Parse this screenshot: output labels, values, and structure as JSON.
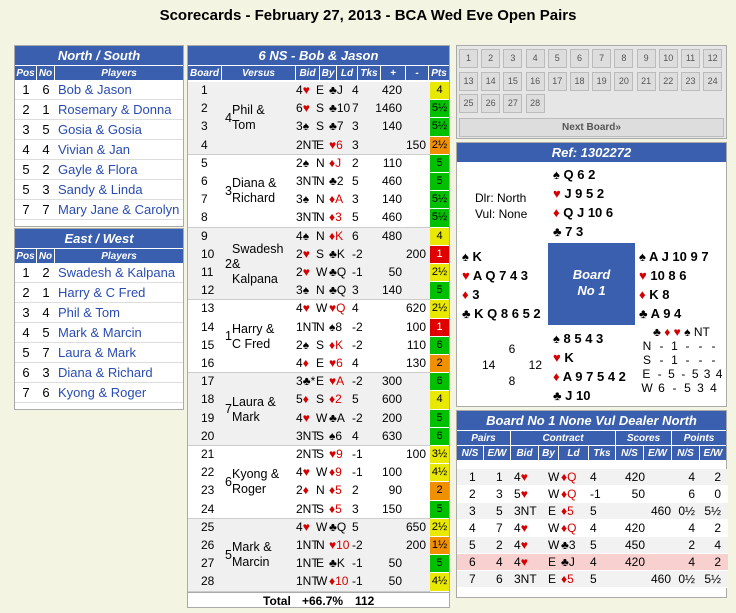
{
  "title": "Scorecards - February 27, 2013 - BCA Wed Eve Open Pairs",
  "ns": {
    "header": "North / South",
    "cols": [
      "Pos",
      "No",
      "Players"
    ],
    "rows": [
      [
        "1",
        "6",
        "Bob & Jason"
      ],
      [
        "2",
        "1",
        "Rosemary & Donna"
      ],
      [
        "3",
        "5",
        "Gosia & Gosia"
      ],
      [
        "4",
        "4",
        "Vivian & Jan"
      ],
      [
        "5",
        "2",
        "Gayle & Flora"
      ],
      [
        "5",
        "3",
        "Sandy & Linda"
      ],
      [
        "7",
        "7",
        "Mary Jane & Carolyn"
      ]
    ]
  },
  "ew": {
    "header": "East / West",
    "cols": [
      "Pos",
      "No",
      "Players"
    ],
    "rows": [
      [
        "1",
        "2",
        "Swadesh & Kalpana"
      ],
      [
        "2",
        "1",
        "Harry & C Fred"
      ],
      [
        "3",
        "4",
        "Phil & Tom"
      ],
      [
        "4",
        "5",
        "Mark & Marcin"
      ],
      [
        "5",
        "7",
        "Laura & Mark"
      ],
      [
        "6",
        "3",
        "Diana & Richard"
      ],
      [
        "7",
        "6",
        "Kyong & Roger"
      ]
    ]
  },
  "card": {
    "header": "6 NS - Bob & Jason",
    "cols": [
      "Board",
      "Versus",
      "Bid",
      "By",
      "Ld",
      "Tks",
      "+",
      "-",
      "Pts"
    ],
    "groups": [
      {
        "num": "4",
        "name": "Phil &\nTom"
      },
      {
        "num": "3",
        "name": "Diana &\nRichard"
      },
      {
        "num": "2",
        "name": "Swadesh\n&\nKalpana"
      },
      {
        "num": "1",
        "name": "Harry &\nC Fred"
      },
      {
        "num": "7",
        "name": "Laura &\nMark"
      },
      {
        "num": "6",
        "name": "Kyong &\nRoger"
      },
      {
        "num": "5",
        "name": "Mark &\nMarcin"
      }
    ],
    "rows": [
      [
        "1",
        "4",
        "♥",
        "E",
        "♣J",
        "4",
        "420",
        "",
        "4",
        "y"
      ],
      [
        "2",
        "6",
        "♥",
        "S",
        "♣10",
        "7",
        "1460",
        "",
        "5½",
        "g"
      ],
      [
        "3",
        "3",
        "♠",
        "S",
        "♣7",
        "3",
        "140",
        "",
        "5½",
        "g"
      ],
      [
        "4",
        "2NT",
        "",
        "E",
        "♥6",
        "3",
        "",
        "150",
        "2½",
        "o"
      ],
      [
        "5",
        "2",
        "♠",
        "N",
        "♦J",
        "2",
        "110",
        "",
        "5",
        "g"
      ],
      [
        "6",
        "3NT",
        "",
        "N",
        "♣2",
        "5",
        "460",
        "",
        "5",
        "g"
      ],
      [
        "7",
        "3",
        "♠",
        "N",
        "♦A",
        "3",
        "140",
        "",
        "5½",
        "g"
      ],
      [
        "8",
        "3NT",
        "",
        "N",
        "♦3",
        "5",
        "460",
        "",
        "5½",
        "g"
      ],
      [
        "9",
        "4",
        "♠",
        "N",
        "♦K",
        "6",
        "480",
        "",
        "4",
        "y"
      ],
      [
        "10",
        "2",
        "♥",
        "S",
        "♣K",
        "-2",
        "",
        "200",
        "1",
        "rd"
      ],
      [
        "11",
        "2",
        "♥",
        "W",
        "♣Q",
        "-1",
        "50",
        "",
        "2½",
        "y"
      ],
      [
        "12",
        "3",
        "♠",
        "N",
        "♣Q",
        "3",
        "140",
        "",
        "5",
        "g"
      ],
      [
        "13",
        "4",
        "♥",
        "W",
        "♥Q",
        "4",
        "",
        "620",
        "2½",
        "y"
      ],
      [
        "14",
        "1NT",
        "",
        "N",
        "♠8",
        "-2",
        "",
        "100",
        "1",
        "rd"
      ],
      [
        "15",
        "2",
        "♠",
        "S",
        "♦K",
        "-2",
        "",
        "110",
        "6",
        "g"
      ],
      [
        "16",
        "4",
        "♦",
        "E",
        "♥6",
        "4",
        "",
        "130",
        "2",
        "o"
      ],
      [
        "17",
        "3",
        "♣*",
        "E",
        "♥A",
        "-2",
        "300",
        "",
        "6",
        "g"
      ],
      [
        "18",
        "5",
        "♦",
        "S",
        "♦2",
        "5",
        "600",
        "",
        "4",
        "y"
      ],
      [
        "19",
        "4",
        "♥",
        "W",
        "♣A",
        "-2",
        "200",
        "",
        "5",
        "g"
      ],
      [
        "20",
        "3NT",
        "",
        "S",
        "♠6",
        "4",
        "630",
        "",
        "6",
        "g"
      ],
      [
        "21",
        "2NT",
        "",
        "S",
        "♥9",
        "-1",
        "",
        "100",
        "3½",
        "y"
      ],
      [
        "22",
        "4",
        "♥",
        "W",
        "♦9",
        "-1",
        "100",
        "",
        "4½",
        "y"
      ],
      [
        "23",
        "2",
        "♦",
        "N",
        "♦5",
        "2",
        "90",
        "",
        "2",
        "o"
      ],
      [
        "24",
        "2NT",
        "",
        "S",
        "♦5",
        "3",
        "150",
        "",
        "5",
        "g"
      ],
      [
        "25",
        "4",
        "♥",
        "W",
        "♣Q",
        "5",
        "",
        "650",
        "2½",
        "y"
      ],
      [
        "26",
        "1NT",
        "",
        "N",
        "♥10",
        "-2",
        "",
        "200",
        "1½",
        "o"
      ],
      [
        "27",
        "1NT",
        "",
        "E",
        "♣K",
        "-1",
        "50",
        "",
        "5",
        "g"
      ],
      [
        "28",
        "1NT",
        "",
        "W",
        "♦10",
        "-1",
        "50",
        "",
        "4½",
        "y"
      ]
    ],
    "total_label": "Total",
    "total_pct": "+66.7%",
    "total_pts": "112"
  },
  "nav": {
    "buttons": [
      "1",
      "2",
      "3",
      "4",
      "5",
      "6",
      "7",
      "8",
      "9",
      "10",
      "11",
      "12",
      "13",
      "14",
      "15",
      "16",
      "17",
      "18",
      "19",
      "20",
      "21",
      "22",
      "23",
      "24",
      "25",
      "26",
      "27",
      "28"
    ],
    "next": "Next Board»"
  },
  "deal": {
    "ref": "Ref: 1302272",
    "dealer": "Dlr: North",
    "vul": "Vul: None",
    "board": "Board",
    "boardno": "No 1",
    "north": [
      "Q 6 2",
      "J 9 5 2",
      "Q J 10 6",
      "7 3"
    ],
    "west": [
      "K",
      "A Q 7 4 3",
      "3",
      "K Q 8 6 5 2"
    ],
    "east": [
      "A J 10 9 7",
      "10 8 6",
      "K 8",
      "A 9 4"
    ],
    "south": [
      "8 5 4 3",
      "K",
      "A 9 7 5 4 2",
      "J 10"
    ],
    "hcp": {
      "n": "6",
      "w": "14",
      "e": "12",
      "s": "8"
    },
    "tricks": [
      [
        "N",
        "-",
        "1",
        "-",
        "-",
        "-"
      ],
      [
        "S",
        "-",
        "1",
        "-",
        "-",
        "-"
      ],
      [
        "E",
        "-",
        "5",
        "-",
        "5",
        "3",
        "4"
      ],
      [
        "W",
        "6",
        "-",
        "5",
        "3",
        "4"
      ]
    ]
  },
  "result": {
    "header": "Board No 1 None Vul Dealer North",
    "groups": [
      "Pairs",
      "Contract",
      "Scores",
      "Points"
    ],
    "cols": [
      "N/S",
      "E/W",
      "Bid",
      "By",
      "Ld",
      "Tks",
      "N/S",
      "E/W",
      "N/S",
      "E/W"
    ],
    "rows": [
      [
        "1",
        "1",
        "4",
        "♥",
        "W",
        "♦Q",
        "4",
        "420",
        "",
        "4",
        "2"
      ],
      [
        "2",
        "3",
        "5",
        "♥",
        "W",
        "♦Q",
        "-1",
        "50",
        "",
        "6",
        "0"
      ],
      [
        "3",
        "5",
        "3NT",
        "",
        "E",
        "♦5",
        "5",
        "",
        "460",
        "0½",
        "5½"
      ],
      [
        "4",
        "7",
        "4",
        "♥",
        "W",
        "♦Q",
        "4",
        "420",
        "",
        "4",
        "2"
      ],
      [
        "5",
        "2",
        "4",
        "♥",
        "W",
        "♣3",
        "5",
        "450",
        "",
        "2",
        "4"
      ],
      [
        "6",
        "4",
        "4",
        "♥",
        "E",
        "♣J",
        "4",
        "420",
        "",
        "4",
        "2"
      ],
      [
        "7",
        "6",
        "3NT",
        "",
        "E",
        "♦5",
        "5",
        "",
        "460",
        "0½",
        "5½"
      ]
    ]
  }
}
